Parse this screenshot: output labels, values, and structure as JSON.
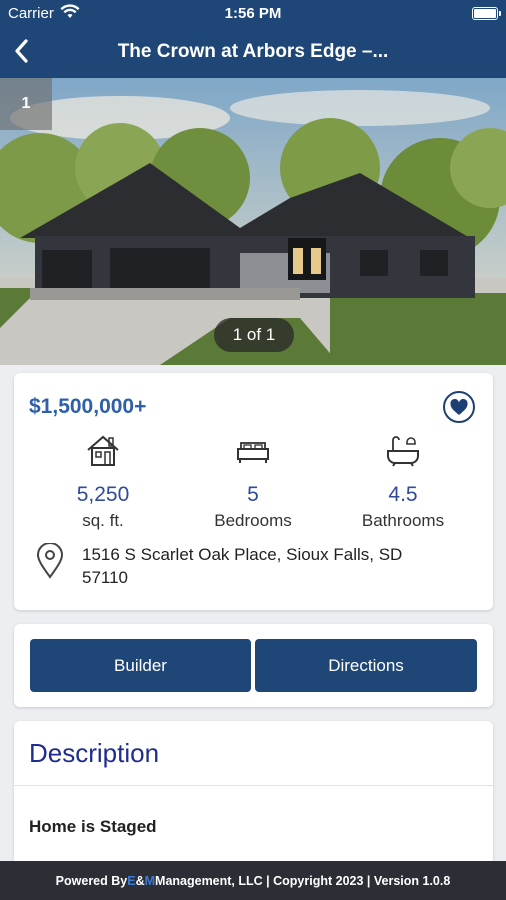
{
  "status_bar": {
    "carrier": "Carrier",
    "time": "1:56 PM"
  },
  "nav": {
    "title": "The Crown at Arbors Edge –..."
  },
  "gallery": {
    "badge": "1",
    "pager": "1 of 1"
  },
  "listing": {
    "price": "$1,500,000+",
    "sqft_value": "5,250",
    "sqft_label": "sq. ft.",
    "beds_value": "5",
    "beds_label": "Bedrooms",
    "baths_value": "4.5",
    "baths_label": "Bathrooms",
    "address_line1": "1516 S Scarlet Oak Place, Sioux Falls, SD",
    "address_line2": "57110"
  },
  "actions": {
    "builder": "Builder",
    "directions": "Directions"
  },
  "description": {
    "title": "Description",
    "body": "Home is Staged"
  },
  "footer": {
    "prefix": "Powered By ",
    "brand_e": "E",
    "brand_amp": "&",
    "brand_m": "M",
    "suffix": " Management, LLC | Copyright 2023 | Version 1.0.8"
  },
  "colors": {
    "header": "#1e4676",
    "price": "#2f5fa8",
    "stat": "#2f4b9a",
    "heading": "#1f2d8f",
    "footer": "#2b2f35"
  },
  "icons": [
    "wifi-icon",
    "battery-icon",
    "back-chevron-icon",
    "heart-icon",
    "house-icon",
    "bed-icon",
    "bathtub-icon",
    "location-pin-icon"
  ]
}
